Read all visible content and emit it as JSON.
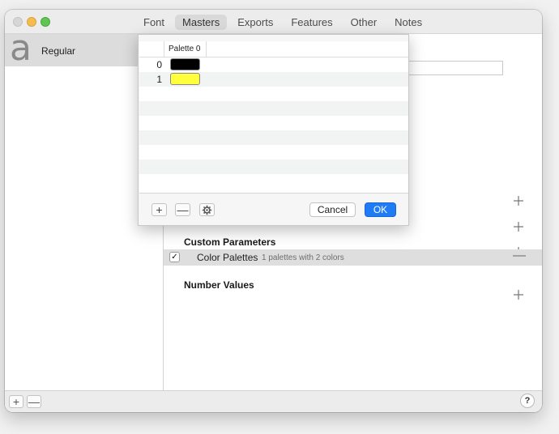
{
  "tabs": [
    {
      "label": "Font"
    },
    {
      "label": "Masters"
    },
    {
      "label": "Exports"
    },
    {
      "label": "Features"
    },
    {
      "label": "Other"
    },
    {
      "label": "Notes"
    }
  ],
  "active_tab": "Masters",
  "sidebar": {
    "master": {
      "glyph": "a",
      "name": "Regular"
    }
  },
  "main": {
    "sections": {
      "custom_parameters": "Custom Parameters",
      "number_values": "Number Values"
    },
    "parameter": {
      "checked": "✓",
      "name": "Color Palettes",
      "value": "1 palettes with 2 colors",
      "remove": "—"
    }
  },
  "palette_sheet": {
    "column_header": "Palette 0",
    "rows": [
      {
        "index": "0",
        "color": "#000000"
      },
      {
        "index": "1",
        "color": "#ffff3b"
      }
    ],
    "buttons": {
      "add": "+",
      "remove": "—",
      "cancel": "Cancel",
      "ok": "OK"
    }
  },
  "bottom": {
    "add": "+",
    "remove": "—",
    "help": "?"
  },
  "colors": {
    "accent": "#1f7cf5",
    "selection": "#dcdcdc"
  }
}
